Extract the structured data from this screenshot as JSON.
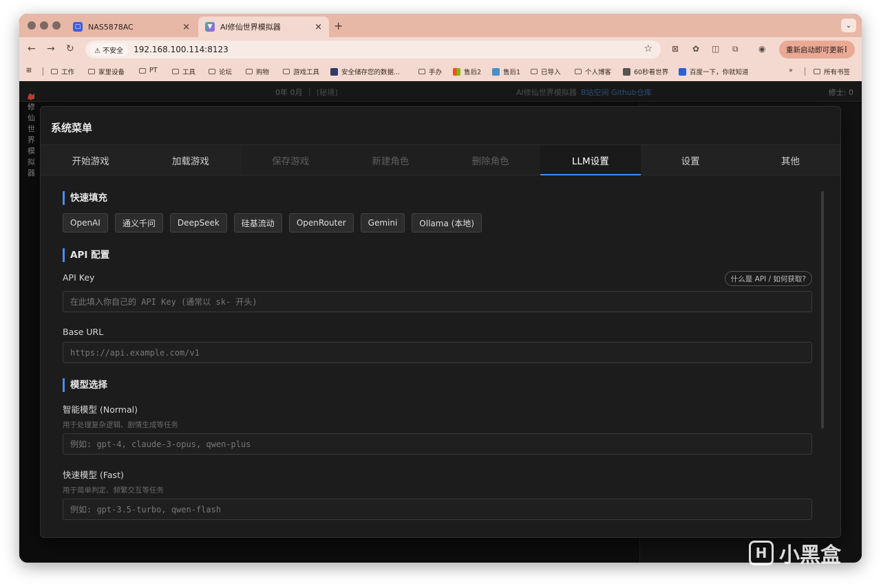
{
  "browser": {
    "tabs": [
      {
        "title": "NAS5878AC",
        "active": false
      },
      {
        "title": "AI修仙世界模拟器",
        "active": true
      }
    ],
    "new_tab_glyph": "+",
    "address": {
      "security_label": "不安全",
      "url": "192.168.100.114:8123"
    },
    "update_button": "重新启动即可更新",
    "bookmarks": [
      "工作",
      "家里设备",
      "PT",
      "工具",
      "论坛",
      "购物",
      "游戏工具",
      "安全储存您的数据...",
      "手办",
      "售后2",
      "售后1",
      "已导入",
      "个人博客",
      "60秒看世界",
      "百度一下，你就知道"
    ],
    "bookmarks_more": "»",
    "all_bookmarks": "所有书签"
  },
  "app": {
    "title": "AI修仙世界模拟器",
    "date": "0年 0月",
    "secret": "[秘境]",
    "center_text": "AI修仙世界模拟器",
    "links": [
      "B站空间",
      "Github仓库"
    ],
    "cultivator": "修士: 0"
  },
  "modal": {
    "title": "系统菜单",
    "tabs": [
      {
        "label": "开始游戏",
        "state": "normal"
      },
      {
        "label": "加载游戏",
        "state": "normal"
      },
      {
        "label": "保存游戏",
        "state": "disabled"
      },
      {
        "label": "新建角色",
        "state": "disabled"
      },
      {
        "label": "删除角色",
        "state": "disabled"
      },
      {
        "label": "LLM设置",
        "state": "active"
      },
      {
        "label": "设置",
        "state": "normal"
      },
      {
        "label": "其他",
        "state": "normal"
      }
    ],
    "quick_fill": {
      "title": "快速填充",
      "presets": [
        "OpenAI",
        "通义千问",
        "DeepSeek",
        "硅基流动",
        "OpenRouter",
        "Gemini",
        "Ollama (本地)"
      ]
    },
    "api": {
      "title": "API 配置",
      "key_label": "API Key",
      "key_placeholder": "在此填入你自己的 API Key (通常以 sk- 开头)",
      "help": "什么是 API / 如何获取?",
      "base_url_label": "Base URL",
      "base_url_placeholder": "https://api.example.com/v1"
    },
    "model": {
      "title": "模型选择",
      "normal_label": "智能模型 (Normal)",
      "normal_hint": "用于处理复杂逻辑、剧情生成等任务",
      "normal_placeholder": "例如: gpt-4, claude-3-opus, qwen-plus",
      "fast_label": "快速模型 (Fast)",
      "fast_hint": "用于简单判定、频繁交互等任务",
      "fast_placeholder": "例如: gpt-3.5-turbo, qwen-flash"
    }
  },
  "watermark": {
    "glyph": "H",
    "text": "小黑盒"
  }
}
